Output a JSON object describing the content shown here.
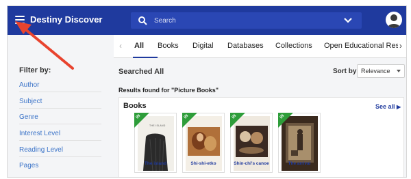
{
  "header": {
    "app_title": "Destiny Discover",
    "search_placeholder": "Search"
  },
  "tabs": [
    {
      "label": "All",
      "active": true
    },
    {
      "label": "Books"
    },
    {
      "label": "Digital"
    },
    {
      "label": "Databases"
    },
    {
      "label": "Collections"
    },
    {
      "label": "Open Educational Reso"
    }
  ],
  "sidebar": {
    "title": "Filter by:",
    "items": [
      "Author",
      "Subject",
      "Genre",
      "Interest Level",
      "Reading Level",
      "Pages"
    ]
  },
  "main": {
    "heading": "Searched All",
    "sort_label": "Sort by:",
    "sort_value": "Relevance",
    "results_text": "Results found for \"Picture Books\""
  },
  "books_section": {
    "title": "Books",
    "see_all": "See all",
    "badge": "IN",
    "items": [
      {
        "title": "The island",
        "cover_text": "THE ISLAND"
      },
      {
        "title": "Shi-shi-etko"
      },
      {
        "title": "Shin-chi's canoe"
      },
      {
        "title": "The arrival"
      }
    ]
  },
  "colors": {
    "header": "#1f3a9e",
    "link": "#3c74c8",
    "badge": "#2e9d3a",
    "annotation_arrow": "#e8432e"
  }
}
